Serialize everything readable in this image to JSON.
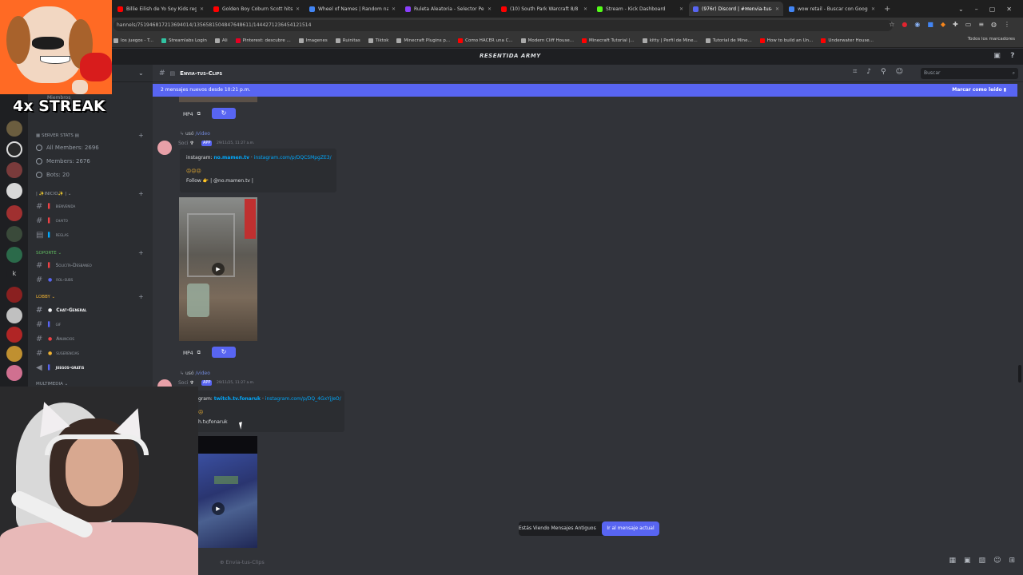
{
  "browser": {
    "tabs": [
      {
        "title": "Billie Eilish de Yo Soy Kids reg",
        "color": "#ff0000",
        "active": false
      },
      {
        "title": "Golden Boy Coburn Scott hits fu",
        "color": "#ff0000",
        "active": false
      },
      {
        "title": "Wheel of Names | Random nam",
        "color": "#4285f4",
        "active": false
      },
      {
        "title": "Ruleta Aleatoria - Selector Per",
        "color": "#8a3ffc",
        "active": false
      },
      {
        "title": "(10) South Park Warcraft 8/8",
        "color": "#ff0000",
        "active": false
      },
      {
        "title": "Stream - Kick Dashboard",
        "color": "#53fc18",
        "active": false
      },
      {
        "title": "(976r) Discord | #✉envia-tus-",
        "color": "#5865f2",
        "active": true
      },
      {
        "title": "wow retail - Buscar con Google",
        "color": "#4285f4",
        "active": false
      }
    ],
    "url": "hannels/751946817213694014/1356581504847648611/1444271236454121514",
    "bookmarks": [
      {
        "label": "los juegos - T...",
        "color": "#aaaaaa"
      },
      {
        "label": "Streamlabs Login",
        "color": "#31c3a2"
      },
      {
        "label": "Ali",
        "color": "#aaaaaa"
      },
      {
        "label": "Pinterest: descubre ...",
        "color": "#e60023"
      },
      {
        "label": "Imagenes",
        "color": "#aaaaaa"
      },
      {
        "label": "Ruinitas",
        "color": "#aaaaaa"
      },
      {
        "label": "Tiktok",
        "color": "#aaaaaa"
      },
      {
        "label": "Minecraft Plugins p...",
        "color": "#aaaaaa"
      },
      {
        "label": "Como HACER una C...",
        "color": "#ff0000"
      },
      {
        "label": "Modern Cliff House...",
        "color": "#aaaaaa"
      },
      {
        "label": "Minecraft Tutorial |...",
        "color": "#ff0000"
      },
      {
        "label": "kitty | Perfil de Mine...",
        "color": "#aaaaaa"
      },
      {
        "label": "Tutorial de Mine...",
        "color": "#aaaaaa"
      },
      {
        "label": "How to build an Un...",
        "color": "#ff0000"
      },
      {
        "label": "Underwater House...",
        "color": "#ff0000"
      }
    ],
    "bookmarks_all": "Todos los marcadores"
  },
  "discord": {
    "server_name": "RESENTIDA ARMY",
    "channel_title": "Envia-tus-Clips",
    "search_placeholder": "Buscar",
    "new_messages": "2 mensajes nuevos desde 10:21 p.m.",
    "mark_read": "Marcar como leído",
    "members_header": "Miembros",
    "server_stats_cat": "SERVER STATS",
    "stats": [
      "All Members: 2696",
      "Members: 2676",
      "Bots: 20"
    ],
    "categories": [
      {
        "label": "| ✨INICIO✨ |",
        "channels": [
          "bienvenida",
          "chaito",
          "reglas"
        ]
      },
      {
        "label": "SOPORTE",
        "channels": [
          "Solicita-Desbaneo",
          "rol-subs"
        ]
      },
      {
        "label": "LOBBY",
        "channels": [
          "Chat-General",
          "gif",
          "Anuncios",
          "sugerencias",
          "juegos-gratis"
        ]
      },
      {
        "label": "MULTIMEDIA",
        "channels": []
      }
    ],
    "messages": [
      {
        "used": "usó",
        "command": "video",
        "app_tag": "APP",
        "timestamp": "29/11/25, 11:27 a.m.",
        "embed_prefix": "instagram:",
        "embed_user": "no.mamen.tv",
        "embed_link": "instagram.com/p/DQCSMpgZE3/",
        "embed_line2": "Follow 👉 | @no.mamen.tv |",
        "button_label": "MP4"
      },
      {
        "used": "usó",
        "command": "video",
        "app_tag": "APP",
        "timestamp": "29/11/25, 11:27 a.m.",
        "embed_prefix": "gram:",
        "embed_user": "twitch.tv.fonaruk",
        "embed_link": "instagram.com/p/DQ_4GxYjJeO/",
        "embed_line2": "h.tv/fonaruk"
      }
    ],
    "old_messages_notice": "Estás Viendo Mensajes Antiguos",
    "jump_button": "Ir al mensaje actual",
    "composer_placeholder": "Envia-tus-Clips"
  },
  "overlay": {
    "streak_text": "4x STREAK"
  }
}
